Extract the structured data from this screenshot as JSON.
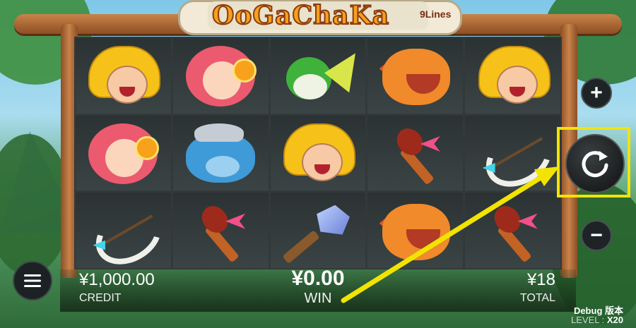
{
  "logo": {
    "title": "OoGaChaKa",
    "lines": "9Lines"
  },
  "reels": [
    [
      "caveman",
      "girl",
      "greendino",
      "orange",
      "caveman"
    ],
    [
      "girl",
      "blue",
      "caveman",
      "torch",
      "bow"
    ],
    [
      "bow",
      "torch",
      "hammer",
      "orange",
      "torch"
    ]
  ],
  "controls": {
    "plus_label": "+",
    "minus_label": "−",
    "menu_icon": "menu-icon",
    "spin_icon": "refresh-icon"
  },
  "credit": {
    "value": "¥1,000.00",
    "label": "CREDIT"
  },
  "win": {
    "value": "¥0.00",
    "label": "WIN"
  },
  "total": {
    "value": "¥18",
    "label": "TOTAL"
  },
  "debug": {
    "text": "Debug 版本"
  },
  "level": {
    "label": "LEVEL : ",
    "value": "X20"
  },
  "colors": {
    "highlight": "#f2e400",
    "arrow": "#f2e400"
  }
}
